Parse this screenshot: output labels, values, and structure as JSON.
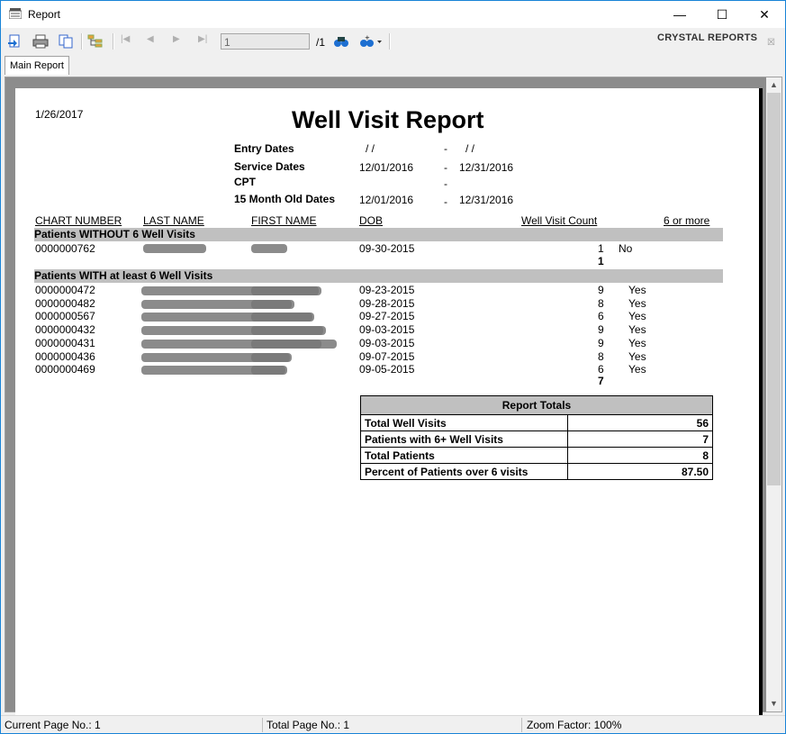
{
  "window": {
    "title": "Report"
  },
  "toolbar": {
    "page_input": "1",
    "page_total": "/1",
    "brand": "CRYSTAL REPORTS"
  },
  "tabs": {
    "main": "Main Report"
  },
  "report": {
    "date": "1/26/2017",
    "title": "Well Visit Report",
    "params": [
      {
        "label": "Entry Dates",
        "from": " /  /",
        "dash": "-",
        "to": " /  /"
      },
      {
        "label": "Service Dates",
        "from": "12/01/2016",
        "dash": "-",
        "to": "12/31/2016"
      },
      {
        "label": "CPT",
        "from": "",
        "dash": "-",
        "to": ""
      },
      {
        "label": "15 Month Old Dates",
        "from": "12/01/2016",
        "dash": "-",
        "to": "12/31/2016"
      }
    ],
    "headers": {
      "chart": "CHART NUMBER",
      "last": "LAST NAME",
      "first": "FIRST NAME",
      "dob": "DOB",
      "count": "Well Visit Count",
      "six": "6 or more"
    },
    "group1": {
      "label": "Patients WITHOUT 6 Well Visits",
      "rows": [
        {
          "chart": "0000000762",
          "dob": "09-30-2015",
          "count": "1",
          "six": "No"
        }
      ],
      "subtotal": "1"
    },
    "group2": {
      "label": "Patients WITH at least 6 Well Visits",
      "rows": [
        {
          "chart": "0000000472",
          "dob": "09-23-2015",
          "count": "9",
          "six": "Yes"
        },
        {
          "chart": "0000000482",
          "dob": "09-28-2015",
          "count": "8",
          "six": "Yes"
        },
        {
          "chart": "0000000567",
          "dob": "09-27-2015",
          "count": "6",
          "six": "Yes"
        },
        {
          "chart": "0000000432",
          "dob": "09-03-2015",
          "count": "9",
          "six": "Yes"
        },
        {
          "chart": "0000000431",
          "dob": "09-03-2015",
          "count": "9",
          "six": "Yes"
        },
        {
          "chart": "0000000436",
          "dob": "09-07-2015",
          "count": "8",
          "six": "Yes"
        },
        {
          "chart": "0000000469",
          "dob": "09-05-2015",
          "count": "6",
          "six": "Yes"
        }
      ],
      "subtotal": "7"
    },
    "totals": {
      "header": "Report Totals",
      "rows": [
        {
          "label": "Total Well Visits",
          "value": "56"
        },
        {
          "label": "Patients with  6+ Well Visits",
          "value": "7"
        },
        {
          "label": "Total Patients",
          "value": "8"
        },
        {
          "label": "Percent of Patients over  6 visits",
          "value": "87.50"
        }
      ]
    }
  },
  "status": {
    "current": "Current Page No.: 1",
    "total": "Total Page No.: 1",
    "zoom": "Zoom Factor: 100%"
  }
}
